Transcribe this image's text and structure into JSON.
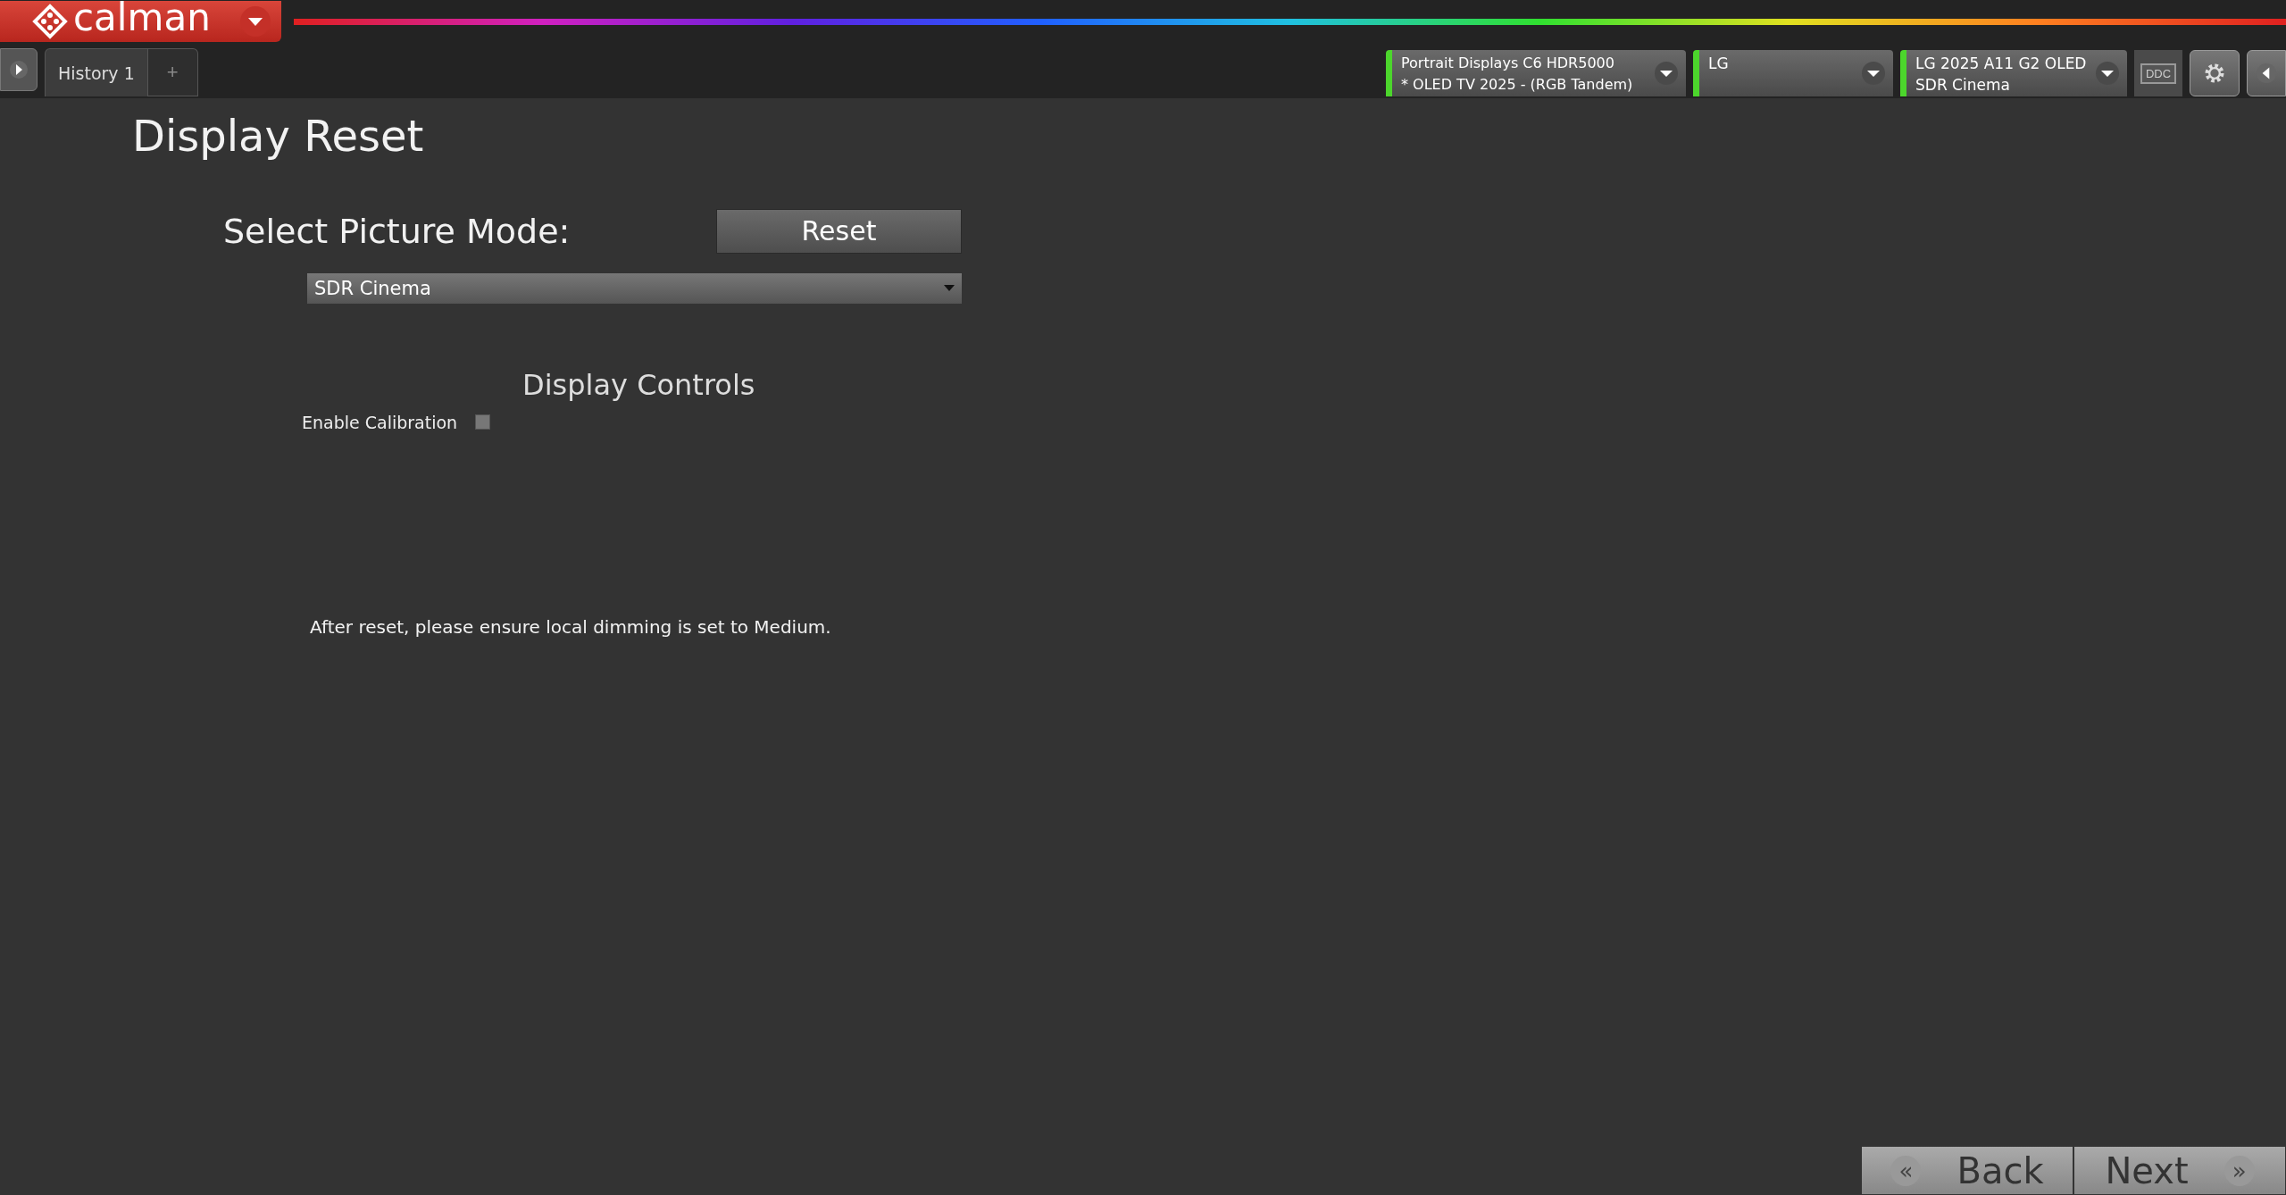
{
  "app": {
    "logo": "calman"
  },
  "tabs": [
    {
      "label": "History 1",
      "selected": true
    }
  ],
  "add_tab": "+",
  "devices": [
    {
      "lines": [
        "Portrait Displays C6 HDR5000",
        "* OLED TV 2025 - (RGB Tandem)"
      ]
    },
    {
      "lines": [
        "LG"
      ]
    },
    {
      "lines": [
        "LG 2025 A11 G2 OLED",
        "SDR Cinema"
      ]
    }
  ],
  "ddc": "DDC",
  "page": {
    "title": "Display Reset",
    "picture_mode_label": "Select Picture Mode:",
    "reset_button": "Reset",
    "picture_mode": {
      "value": "SDR Cinema"
    },
    "section_title": "Display Controls",
    "enable_calibration": {
      "label": "Enable Calibration",
      "checked": false
    },
    "note": "After reset, please ensure local dimming is set to Medium."
  },
  "nav": {
    "back": {
      "arrow": "«",
      "label": "Back"
    },
    "next": {
      "label": "Next",
      "arrow": "»"
    }
  }
}
